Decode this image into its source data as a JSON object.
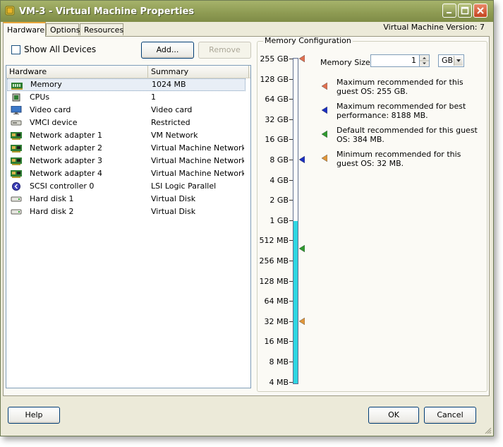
{
  "window": {
    "title": "VM-3 - Virtual Machine Properties",
    "version_label": "Virtual Machine Version: 7"
  },
  "tabs": [
    {
      "label": "Hardware",
      "active": true
    },
    {
      "label": "Options",
      "active": false
    },
    {
      "label": "Resources",
      "active": false
    }
  ],
  "hardware_panel": {
    "show_all_devices_label": "Show All Devices",
    "show_all_devices_checked": false,
    "add_label": "Add...",
    "remove_label": "Remove",
    "columns": [
      "Hardware",
      "Summary"
    ],
    "rows": [
      {
        "icon": "memory-icon",
        "name": "Memory",
        "summary": "1024 MB",
        "selected": true
      },
      {
        "icon": "cpu-icon",
        "name": "CPUs",
        "summary": "1",
        "selected": false
      },
      {
        "icon": "monitor-icon",
        "name": "Video card",
        "summary": "Video card",
        "selected": false
      },
      {
        "icon": "device-icon",
        "name": "VMCI device",
        "summary": "Restricted",
        "selected": false
      },
      {
        "icon": "network-adapter-icon",
        "name": "Network adapter 1",
        "summary": "VM Network",
        "selected": false
      },
      {
        "icon": "network-adapter-icon",
        "name": "Network adapter 2",
        "summary": "Virtual Machine Network",
        "selected": false
      },
      {
        "icon": "network-adapter-icon",
        "name": "Network adapter 3",
        "summary": "Virtual Machine Network...",
        "selected": false
      },
      {
        "icon": "network-adapter-icon",
        "name": "Network adapter 4",
        "summary": "Virtual Machine Network...",
        "selected": false
      },
      {
        "icon": "scsi-controller-icon",
        "name": "SCSI controller 0",
        "summary": "LSI Logic Parallel",
        "selected": false
      },
      {
        "icon": "hard-disk-icon",
        "name": "Hard disk 1",
        "summary": "Virtual Disk",
        "selected": false
      },
      {
        "icon": "hard-disk-icon",
        "name": "Hard disk 2",
        "summary": "Virtual Disk",
        "selected": false
      }
    ]
  },
  "memory_config": {
    "group_title": "Memory Configuration",
    "scale_labels": [
      "255 GB",
      "128 GB",
      "64 GB",
      "32 GB",
      "16 GB",
      "8 GB",
      "4 GB",
      "2 GB",
      "1 GB",
      "512 MB",
      "256 MB",
      "128 MB",
      "64 MB",
      "32 MB",
      "16 MB",
      "8 MB",
      "4 MB"
    ],
    "current_fill_level_label": "1 GB",
    "memory_size_label": "Memory Size:",
    "memory_size_value": "1",
    "unit_value": "GB",
    "markers": [
      {
        "level_label": "255 GB",
        "color": "#e07050",
        "text": "Maximum recommended for this guest OS: 255 GB."
      },
      {
        "level_label": "8 GB",
        "color": "#1b2fc0",
        "text": "Maximum recommended for best performance: 8188 MB."
      },
      {
        "level_label": "384 MB",
        "color": "#2f9a2f",
        "text": "Default recommended for this guest OS: 384 MB."
      },
      {
        "level_label": "32 MB",
        "color": "#e0963a",
        "text": "Minimum recommended for this guest OS: 32 MB."
      }
    ]
  },
  "footer": {
    "help_label": "Help",
    "ok_label": "OK",
    "cancel_label": "Cancel"
  }
}
